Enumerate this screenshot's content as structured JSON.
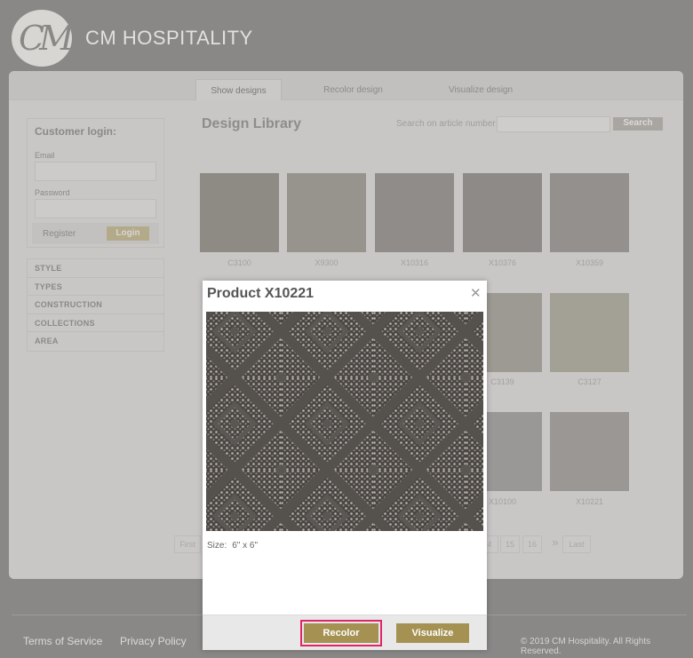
{
  "brand": {
    "logo_text": "CM",
    "name": "CM HOSPITALITY"
  },
  "tabs": [
    {
      "label": "Show designs",
      "active": true
    },
    {
      "label": "Recolor design",
      "active": false
    },
    {
      "label": "Visualize design",
      "active": false
    }
  ],
  "login": {
    "title": "Customer login:",
    "email_label": "Email",
    "password_label": "Password",
    "register_label": "Register",
    "login_button": "Login"
  },
  "filters": [
    "STYLE",
    "TYPES",
    "CONSTRUCTION",
    "COLLECTIONS",
    "AREA"
  ],
  "library": {
    "title": "Design Library",
    "search_label": "Search on article number:",
    "search_button": "Search",
    "items": [
      {
        "code": "C3100",
        "color": "#8e8b84"
      },
      {
        "code": "X9300",
        "color": "#97938d"
      },
      {
        "code": "X10316",
        "color": "#8f8c89"
      },
      {
        "code": "X10376",
        "color": "#8d8a87"
      },
      {
        "code": "X10359",
        "color": "#93908d"
      },
      {
        "code": "C3139",
        "color": "#9c9a92"
      },
      {
        "code": "C3127",
        "color": "#a3a096"
      },
      {
        "code": "X10100",
        "color": "#9a9896"
      },
      {
        "code": "X10221",
        "color": "#9a9794"
      }
    ],
    "pager": {
      "first": "First",
      "p15": "15",
      "p16": "16",
      "next": "»",
      "last": "Last",
      "partial": "4"
    }
  },
  "footer": {
    "terms": "Terms of Service",
    "privacy": "Privacy Policy",
    "copyright": "© 2019 CM Hospitality. All Rights Reserved."
  },
  "modal": {
    "title": "Product X10221",
    "close_icon": "close-icon",
    "size_label": "Size:",
    "size_value": "6\" x 6\"",
    "recolor_button": "Recolor",
    "visualize_button": "Visualize",
    "accent": "#a59253",
    "highlight": "#e0246a"
  }
}
